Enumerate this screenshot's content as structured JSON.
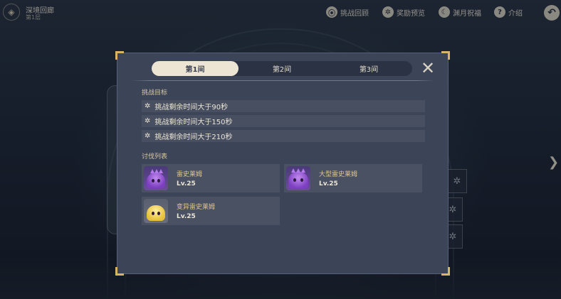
{
  "header": {
    "title": "深境回廊",
    "subtitle": "第1层",
    "buttons": [
      {
        "label": "挑战回顾",
        "icon": "replay-icon"
      },
      {
        "label": "奖励预览",
        "icon": "gear-icon"
      },
      {
        "label": "渊月祝福",
        "icon": "moon-icon"
      },
      {
        "label": "介绍",
        "icon": "help-icon"
      }
    ],
    "back_icon": "back-arrow-icon"
  },
  "modal": {
    "tabs": [
      {
        "label": "第1间",
        "active": true
      },
      {
        "label": "第2间",
        "active": false
      },
      {
        "label": "第3间",
        "active": false
      }
    ],
    "objectives_title": "挑战目标",
    "objectives": [
      "挑战剩余时间大于90秒",
      "挑战剩余时间大于150秒",
      "挑战剩余时间大于210秒"
    ],
    "enemies_title": "讨伐列表",
    "enemies": [
      {
        "name": "雷史莱姆",
        "level": "Lv.25",
        "type": "electro"
      },
      {
        "name": "大型雷史莱姆",
        "level": "Lv.25",
        "type": "electro-large"
      },
      {
        "name": "变异雷史莱姆",
        "level": "Lv.25",
        "type": "mutant"
      }
    ]
  },
  "colors": {
    "accent_gold": "#d8b46a",
    "modal_bg": "#3c4458",
    "tab_active": "#ece5d3",
    "enemy_name": "#e2c68a"
  }
}
